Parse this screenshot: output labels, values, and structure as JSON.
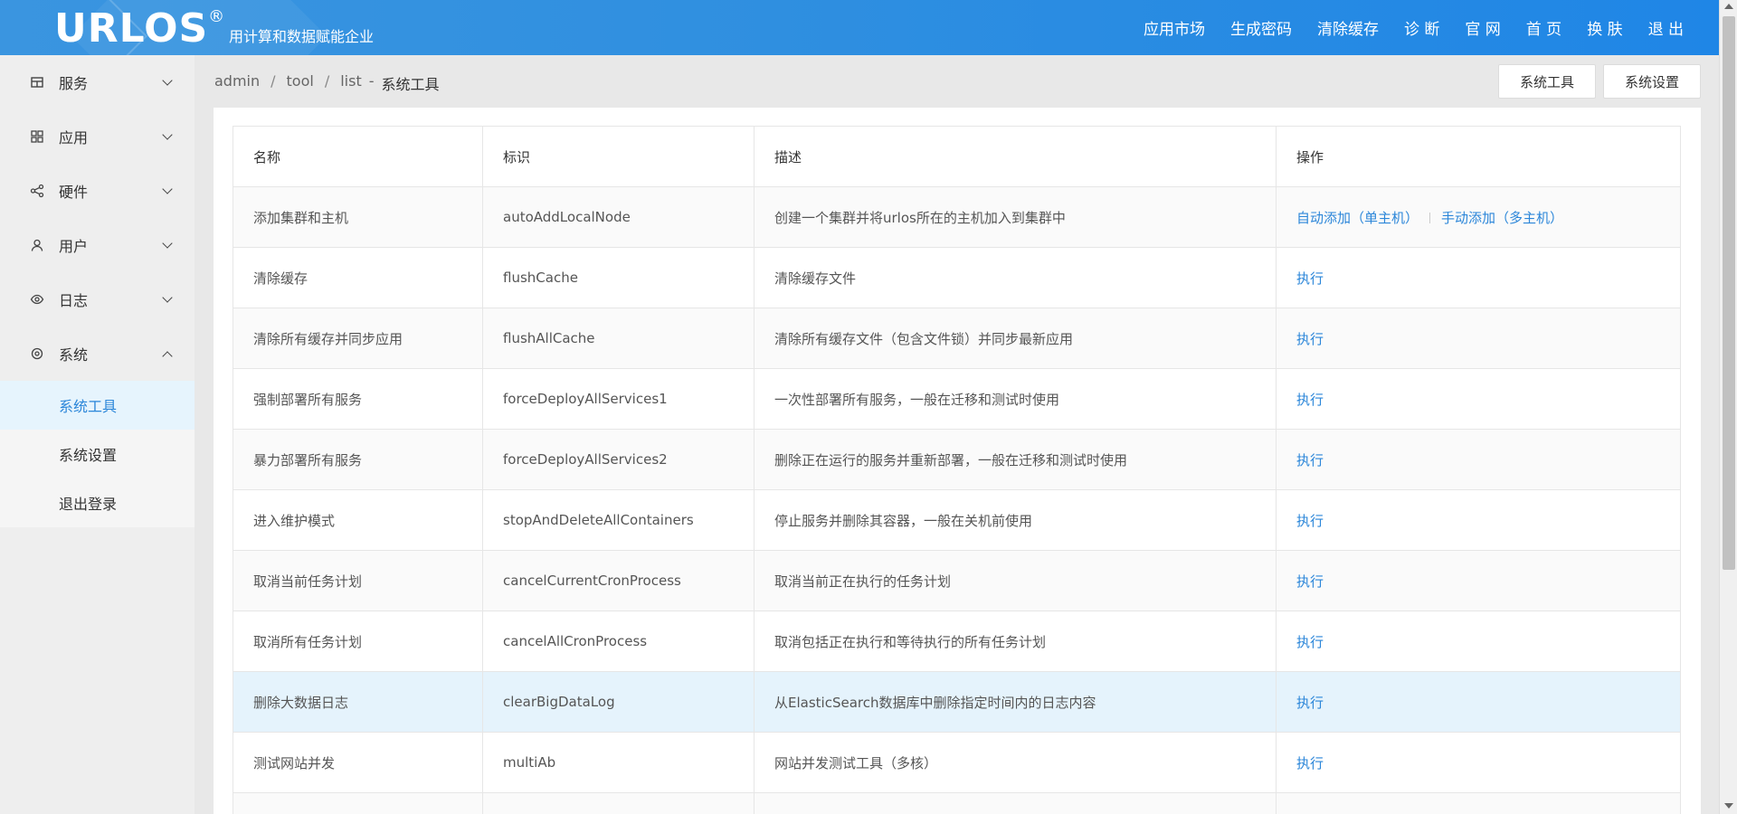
{
  "header": {
    "logo": "URLOS",
    "logo_mark": "®",
    "slogan": "用计算和数据赋能企业",
    "nav": [
      "应用市场",
      "生成密码",
      "清除缓存",
      "诊 断",
      "官 网",
      "首 页",
      "换 肤",
      "退 出"
    ]
  },
  "sidebar": {
    "items": [
      {
        "label": "服务",
        "icon": "service-icon",
        "expanded": false
      },
      {
        "label": "应用",
        "icon": "grid-icon",
        "expanded": false
      },
      {
        "label": "硬件",
        "icon": "share-icon",
        "expanded": false
      },
      {
        "label": "用户",
        "icon": "user-icon",
        "expanded": false
      },
      {
        "label": "日志",
        "icon": "eye-icon",
        "expanded": false
      },
      {
        "label": "系统",
        "icon": "gear-icon",
        "expanded": true
      }
    ],
    "submenu": [
      "系统工具",
      "系统设置",
      "退出登录"
    ],
    "active_sub": "系统工具"
  },
  "breadcrumb": {
    "parts": [
      "admin",
      "tool",
      "list"
    ],
    "dash": "-",
    "current": "系统工具"
  },
  "top_buttons": [
    "系统工具",
    "系统设置"
  ],
  "table": {
    "headers": [
      "名称",
      "标识",
      "描述",
      "操作"
    ],
    "rows": [
      {
        "name": "添加集群和主机",
        "id": "autoAddLocalNode",
        "desc": "创建一个集群并将urlos所在的主机加入到集群中",
        "actions": [
          "自动添加（单主机）",
          "手动添加（多主机）"
        ]
      },
      {
        "name": "清除缓存",
        "id": "flushCache",
        "desc": "清除缓存文件",
        "actions": [
          "执行"
        ]
      },
      {
        "name": "清除所有缓存并同步应用",
        "id": "flushAllCache",
        "desc": "清除所有缓存文件（包含文件锁）并同步最新应用",
        "actions": [
          "执行"
        ]
      },
      {
        "name": "强制部署所有服务",
        "id": "forceDeployAllServices1",
        "desc": "一次性部署所有服务，一般在迁移和测试时使用",
        "actions": [
          "执行"
        ]
      },
      {
        "name": "暴力部署所有服务",
        "id": "forceDeployAllServices2",
        "desc": "删除正在运行的服务并重新部署，一般在迁移和测试时使用",
        "actions": [
          "执行"
        ]
      },
      {
        "name": "进入维护模式",
        "id": "stopAndDeleteAllContainers",
        "desc": "停止服务并删除其容器，一般在关机前使用",
        "actions": [
          "执行"
        ]
      },
      {
        "name": "取消当前任务计划",
        "id": "cancelCurrentCronProcess",
        "desc": "取消当前正在执行的任务计划",
        "actions": [
          "执行"
        ]
      },
      {
        "name": "取消所有任务计划",
        "id": "cancelAllCronProcess",
        "desc": "取消包括正在执行和等待执行的所有任务计划",
        "actions": [
          "执行"
        ]
      },
      {
        "name": "删除大数据日志",
        "id": "clearBigDataLog",
        "desc": "从ElasticSearch数据库中删除指定时间内的日志内容",
        "actions": [
          "执行"
        ],
        "highlighted": true
      },
      {
        "name": "测试网站并发",
        "id": "multiAb",
        "desc": "网站并发测试工具（多核）",
        "actions": [
          "执行"
        ]
      },
      {
        "name": "",
        "id": "",
        "desc": "",
        "actions": []
      }
    ]
  }
}
